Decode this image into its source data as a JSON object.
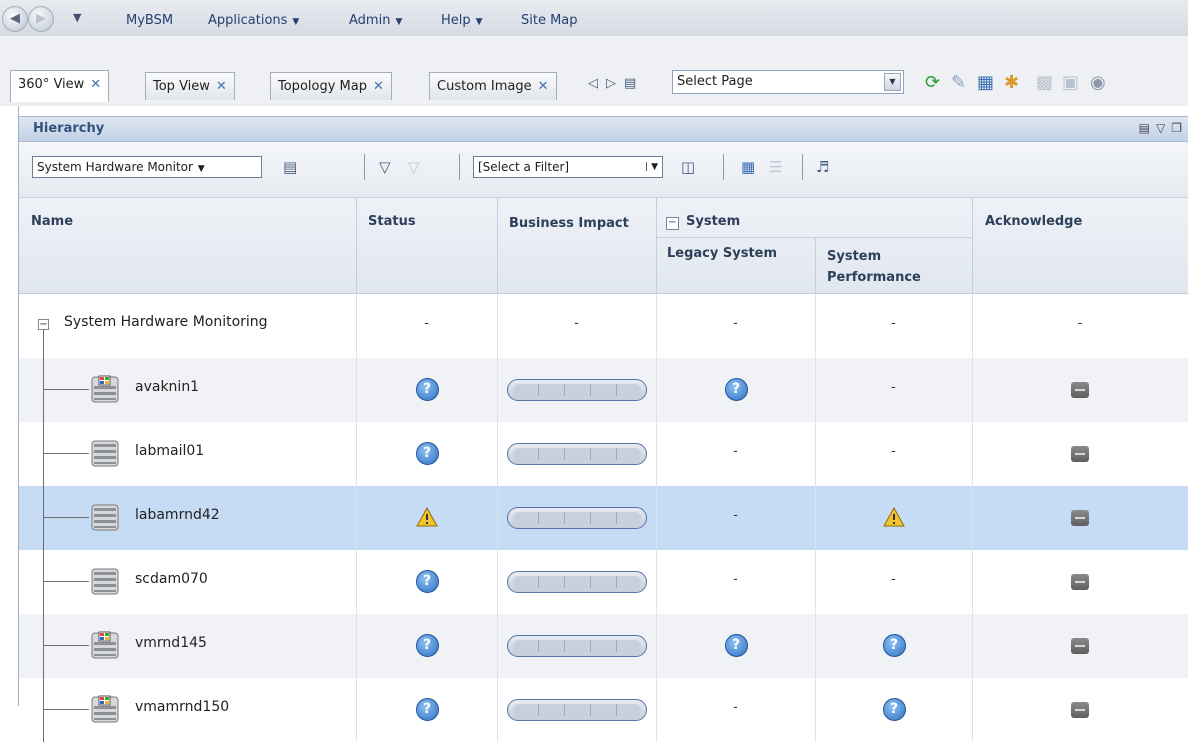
{
  "menubar": {
    "items": [
      {
        "label": "MyBSM",
        "has_dropdown": false
      },
      {
        "label": "Applications",
        "has_dropdown": true
      },
      {
        "label": "Admin",
        "has_dropdown": true
      },
      {
        "label": "Help",
        "has_dropdown": true
      },
      {
        "label": "Site Map",
        "has_dropdown": false
      }
    ]
  },
  "tabs": [
    {
      "label": "360° View",
      "active": true
    },
    {
      "label": "Top View",
      "active": false
    },
    {
      "label": "Topology Map",
      "active": false
    },
    {
      "label": "Custom Image",
      "active": false
    }
  ],
  "select_page": {
    "value": "Select Page"
  },
  "panel": {
    "title": "Hierarchy"
  },
  "toolbar": {
    "view_select": "System Hardware Monitor",
    "filter_select": "[Select a Filter]"
  },
  "columns": {
    "name": "Name",
    "status": "Status",
    "business_impact": "Business Impact",
    "system": "System",
    "legacy_system": "Legacy System",
    "system_performance": "System Performance",
    "acknowledge": "Acknowledge"
  },
  "rows": [
    {
      "name": "System Hardware Monitoring",
      "root": true,
      "status": "-",
      "business_impact": "-",
      "legacy_system": "-",
      "system_performance": "-",
      "acknowledge": "-"
    },
    {
      "name": "avaknin1",
      "icon": "windows-server-icon",
      "status": "unknown",
      "business_impact": "bar",
      "legacy_system": "unknown",
      "system_performance": "-",
      "acknowledge": "ack"
    },
    {
      "name": "labmail01",
      "icon": "server-icon",
      "status": "unknown",
      "business_impact": "bar",
      "legacy_system": "-",
      "system_performance": "-",
      "acknowledge": "ack"
    },
    {
      "name": "labamrnd42",
      "icon": "server-icon",
      "status": "warning",
      "business_impact": "bar",
      "legacy_system": "-",
      "system_performance": "warning",
      "acknowledge": "ack",
      "selected": true
    },
    {
      "name": "scdam070",
      "icon": "server-icon",
      "status": "unknown",
      "business_impact": "bar",
      "legacy_system": "-",
      "system_performance": "-",
      "acknowledge": "ack"
    },
    {
      "name": "vmrnd145",
      "icon": "windows-server-icon",
      "status": "unknown",
      "business_impact": "bar",
      "legacy_system": "unknown",
      "system_performance": "unknown",
      "acknowledge": "ack"
    },
    {
      "name": "vmamrnd150",
      "icon": "windows-server-icon",
      "status": "unknown",
      "business_impact": "bar",
      "legacy_system": "-",
      "system_performance": "unknown",
      "acknowledge": "ack"
    }
  ],
  "colors": {
    "accent": "#33527c",
    "selected_row": "#c6dbf4",
    "status_unknown": "#2e6fc3",
    "status_warning": "#f2c200"
  }
}
